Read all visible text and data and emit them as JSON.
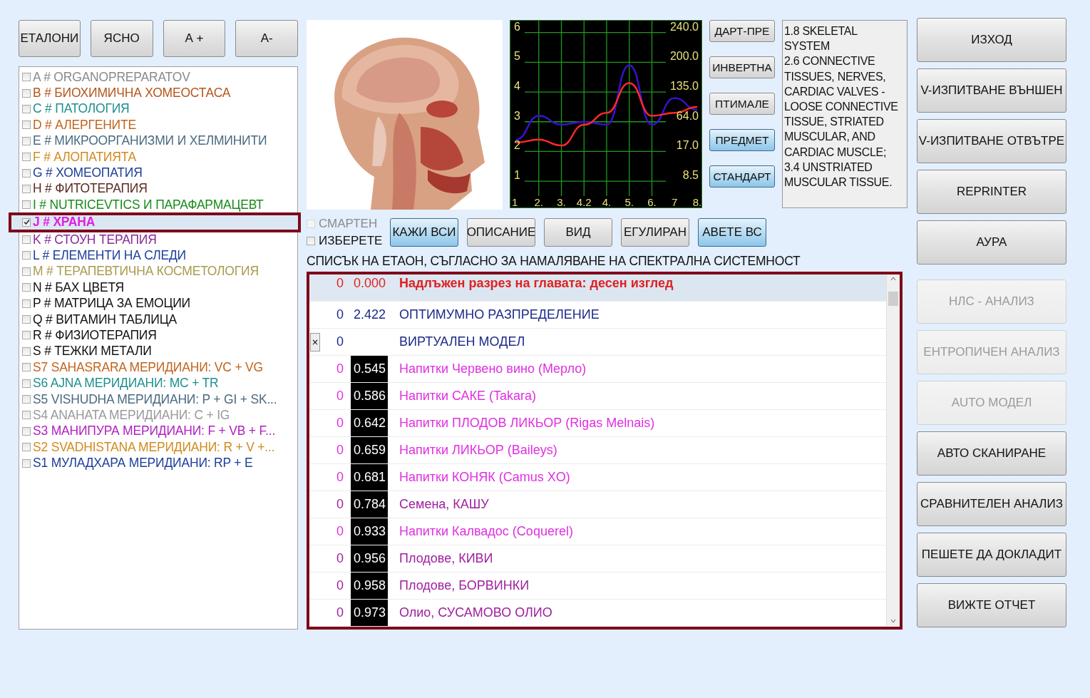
{
  "top_buttons": [
    "ЕТАЛОНИ",
    "ЯСНО",
    "А +",
    "А-"
  ],
  "categories": [
    {
      "label": "A # ORGANOPREPARATOV",
      "color": "#8a8a8a",
      "checked": false,
      "selected": false
    },
    {
      "label": "B # БИОХИМИЧНА ХОМЕОСТАСА",
      "color": "#b5561c",
      "checked": false,
      "selected": false
    },
    {
      "label": "C # ПАТОЛОГИЯ",
      "color": "#1f8f8f",
      "checked": false,
      "selected": false
    },
    {
      "label": "D # АЛЕРГЕНИТЕ",
      "color": "#c0641c",
      "checked": false,
      "selected": false
    },
    {
      "label": "E # МИКРООРГАНИЗМИ И ХЕЛМИНИТИ",
      "color": "#4a6a80",
      "checked": false,
      "selected": false
    },
    {
      "label": "F # АЛОПАТИЯТА",
      "color": "#d08a20",
      "checked": false,
      "selected": false
    },
    {
      "label": "G # ХОМЕОПАТИЯ",
      "color": "#1d3f9a",
      "checked": false,
      "selected": false
    },
    {
      "label": "H # ФИТОТЕРАПИЯ",
      "color": "#5a2a20",
      "checked": false,
      "selected": false
    },
    {
      "label": "I # NUTRICEVTICS И ПАРАФАРМАЦЕВТ",
      "color": "#1a8a1a",
      "checked": false,
      "selected": false
    },
    {
      "label": "J # ХРАНА",
      "color": "#e020e0",
      "checked": true,
      "selected": true
    },
    {
      "label": "K # СТОУН ТЕРАПИЯ",
      "color": "#8a2a9a",
      "checked": false,
      "selected": false
    },
    {
      "label": "L # ЕЛЕМЕНТИ НА СЛЕДИ",
      "color": "#1d3f9a",
      "checked": false,
      "selected": false
    },
    {
      "label": "M # ТЕРАПЕВТИЧНА КОСМЕТОЛОГИЯ",
      "color": "#a89a50",
      "checked": false,
      "selected": false
    },
    {
      "label": "N # БАХ ЦВЕТЯ",
      "color": "#111111",
      "checked": false,
      "selected": false
    },
    {
      "label": "P # МАТРИЦА ЗА ЕМОЦИИ",
      "color": "#111111",
      "checked": false,
      "selected": false
    },
    {
      "label": "Q # ВИТАМИН ТАБЛИЦА",
      "color": "#111111",
      "checked": false,
      "selected": false
    },
    {
      "label": "R # ФИЗИОТЕРАПИЯ",
      "color": "#111111",
      "checked": false,
      "selected": false
    },
    {
      "label": "S # ТЕЖКИ МЕТАЛИ",
      "color": "#111111",
      "checked": false,
      "selected": false
    },
    {
      "label": "S7 SAHASRARA МЕРИДИАНИ: VC + VG",
      "color": "#c0641c",
      "checked": false,
      "selected": false
    },
    {
      "label": "S6 AJNA МЕРИДИАНИ: MC + TR",
      "color": "#1f8f8f",
      "checked": false,
      "selected": false
    },
    {
      "label": "S5 VISHUDHA МЕРИДИАНИ: P + GI + SK...",
      "color": "#4a6a80",
      "checked": false,
      "selected": false
    },
    {
      "label": "S4 ANAHATA МЕРИДИАНИ: C + IG",
      "color": "#999999",
      "checked": false,
      "selected": false
    },
    {
      "label": "S3 МАНИПУРА МЕРИДИАНИ: F + VB + F...",
      "color": "#b020c0",
      "checked": false,
      "selected": false
    },
    {
      "label": "S2 SVADHISTANA МЕРИДИАНИ: R + V +...",
      "color": "#d08a20",
      "checked": false,
      "selected": false
    },
    {
      "label": "S1 МУЛАДХАРА МЕРИДИАНИ: RP + E",
      "color": "#1d3f9a",
      "checked": false,
      "selected": false
    }
  ],
  "chart": {
    "chart_data": {
      "type": "line",
      "categories": [
        "1",
        "2.",
        "3.",
        "4.2",
        "4.",
        "5.",
        "6.",
        "7",
        "8."
      ],
      "yticks": [
        1,
        2,
        3,
        4,
        5,
        6
      ],
      "ylim": [
        0.5,
        6.4
      ],
      "grid": true,
      "annotations": [
        "240.0",
        "200.0",
        "135.0",
        "64.0",
        "17.0",
        "8.5"
      ],
      "series": [
        {
          "color": "#3a10d0",
          "values": [
            2.4,
            3.2,
            2.9,
            3.0,
            2.9,
            4.9,
            2.9,
            3.8,
            3.4
          ]
        },
        {
          "color": "#ff2a2a",
          "values": [
            2.3,
            2.4,
            2.2,
            2.9,
            3.3,
            4.3,
            3.2,
            3.3,
            3.5
          ]
        }
      ]
    }
  },
  "chart_buttons": [
    {
      "label": "ДАРТ-ПРЕ",
      "kind": "plain"
    },
    {
      "label": "ИНВЕРТНА",
      "kind": "plain"
    },
    {
      "label": "ПТИМАЛЕ",
      "kind": "plain"
    },
    {
      "label": "ПРЕДМЕТ",
      "kind": "blue"
    },
    {
      "label": "СТАНДАРТ",
      "kind": "blue"
    }
  ],
  "description": "1.8 SKELETAL SYSTEM\n2.6 CONNECTIVE TISSUES, NERVES, CARDIAC VALVES - LOOSE CONNECTIVE TISSUE, STRIATED MUSCULAR, AND CARDIAC MUSCLE;\n3.4 UNSTRIATED MUSCULAR TISSUE.",
  "filters": [
    {
      "label": "СМАРТЕН",
      "checked": false,
      "disabled": true
    },
    {
      "label": "ИЗБЕРЕТЕ",
      "checked": false,
      "disabled": false
    }
  ],
  "action_buttons": [
    {
      "label": "КАЖИ ВСИ",
      "kind": "blue"
    },
    {
      "label": "ОПИСАНИЕ",
      "kind": "plain"
    },
    {
      "label": "ВИД",
      "kind": "plain"
    },
    {
      "label": "ЕГУЛИРАН",
      "kind": "plain"
    },
    {
      "label": "АВЕТЕ ВС",
      "kind": "blue"
    }
  ],
  "list_title": "СПИСЪК НА ЕТАОН, СЪГЛАСНО ЗА НАМАЛЯВАНЕ НА СПЕКТРАЛНА СИСТЕМНОСТ",
  "table": {
    "rows": [
      {
        "index": "0",
        "value": "0.000",
        "name": "Надлъжен разрез на главата: десен изглед",
        "color": "#e02020",
        "kind": "header",
        "selected": true
      },
      {
        "index": "0",
        "value": "2.422",
        "name": "ОПТИМУМНО РАЗПРЕДЕЛЕНИЕ",
        "color": "#1d2a8a",
        "kind": "plain",
        "selected": false
      },
      {
        "index": "0",
        "name": "ВИРТУАЛЕН МОДЕЛ",
        "color": "#1d2a8a",
        "kind": "plain",
        "selected": false,
        "close": "×"
      },
      {
        "index": "0",
        "value": "0.545",
        "name": "Напитки Червено вино (Мерло)",
        "color": "#e030e0",
        "kind": "dark",
        "selected": false
      },
      {
        "index": "0",
        "value": "0.586",
        "name": "Напитки САКЕ (Takara)",
        "color": "#e030e0",
        "kind": "dark",
        "selected": false
      },
      {
        "index": "0",
        "value": "0.642",
        "name": "Напитки ПЛОДОВ ЛИКЬОР (Rigas Melnais)",
        "color": "#e030e0",
        "kind": "dark",
        "selected": false
      },
      {
        "index": "0",
        "value": "0.659",
        "name": "Напитки ЛИКЬОР (Baileys)",
        "color": "#e030e0",
        "kind": "dark",
        "selected": false
      },
      {
        "index": "0",
        "value": "0.681",
        "name": "Напитки КОНЯК (Camus XO)",
        "color": "#e030e0",
        "kind": "dark",
        "selected": false
      },
      {
        "index": "0",
        "value": "0.784",
        "name": "Семена, КАШУ",
        "color": "#a020a0",
        "kind": "dark",
        "selected": false
      },
      {
        "index": "0",
        "value": "0.933",
        "name": "Напитки Калвадос (Coquerel)",
        "color": "#e030e0",
        "kind": "dark",
        "selected": false
      },
      {
        "index": "0",
        "value": "0.956",
        "name": "Плодове, КИВИ",
        "color": "#a020a0",
        "kind": "dark",
        "selected": false
      },
      {
        "index": "0",
        "value": "0.958",
        "name": "Плодове, БОРВИНКИ",
        "color": "#a020a0",
        "kind": "dark",
        "selected": false
      },
      {
        "index": "0",
        "value": "0.973",
        "name": "Олио, СУСАМОВО ОЛИО",
        "color": "#a020a0",
        "kind": "dark",
        "selected": false
      }
    ]
  },
  "side_buttons": [
    {
      "label": "ИЗХОД",
      "disabled": false
    },
    {
      "label": "V-ИЗПИТВАНЕ ВЪНШЕН",
      "disabled": false
    },
    {
      "label": "V-ИЗПИТВАНЕ ОТВЪТРЕ",
      "disabled": false
    },
    {
      "label": "REPRINTER",
      "disabled": false
    },
    {
      "label": "АУРА",
      "disabled": false
    },
    {
      "label": "НЛС - АНАЛИЗ",
      "disabled": true
    },
    {
      "label": "ЕНТРОПИЧЕН АНАЛИЗ",
      "disabled": true
    },
    {
      "label": "AUTO МОДЕЛ",
      "disabled": true
    },
    {
      "label": "АВТО СКАНИРАНЕ",
      "disabled": false
    },
    {
      "label": "СРАВНИТЕЛЕН АНАЛИЗ",
      "disabled": false
    },
    {
      "label": "ПЕШЕТЕ ДА ДОКЛАДИТ",
      "disabled": false
    },
    {
      "label": "ВИЖТЕ ОТЧЕТ",
      "disabled": false
    }
  ]
}
